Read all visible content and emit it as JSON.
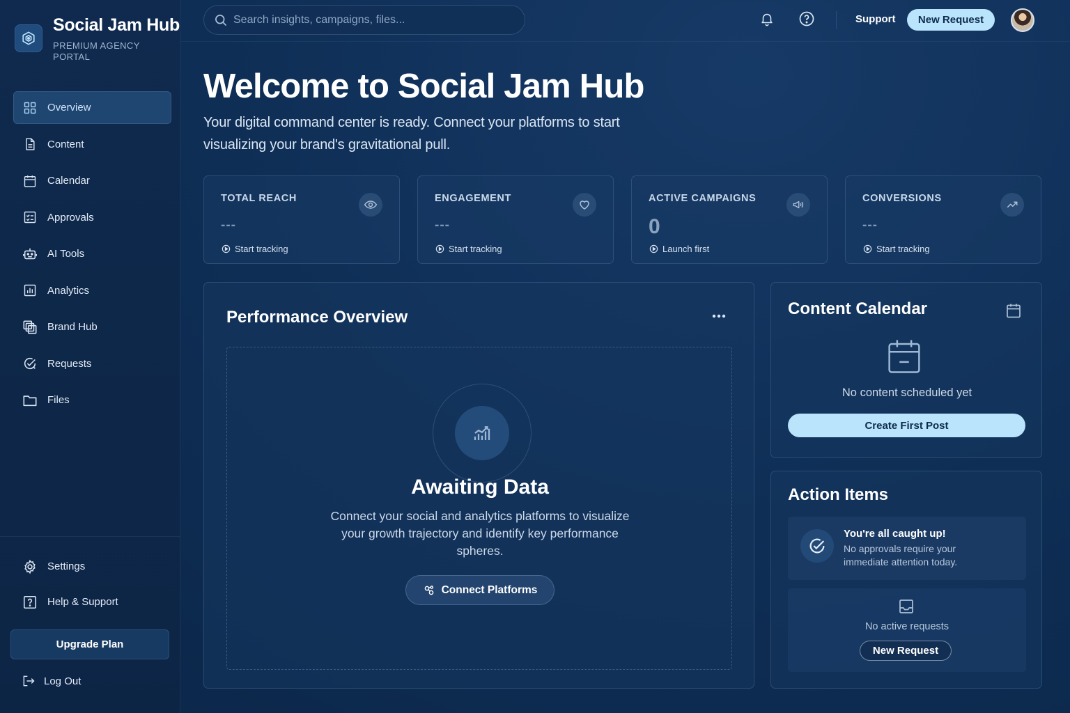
{
  "brand": {
    "name": "Social Jam Hub",
    "subtitle_line1": "PREMIUM AGENCY",
    "subtitle_line2": "PORTAL",
    "logo_icon": "hexagon-logo-icon"
  },
  "sidebar": {
    "items": [
      {
        "label": "Overview",
        "icon": "grid-icon",
        "active": true
      },
      {
        "label": "Content",
        "icon": "document-icon"
      },
      {
        "label": "Calendar",
        "icon": "calendar-icon"
      },
      {
        "label": "Approvals",
        "icon": "checklist-icon"
      },
      {
        "label": "AI Tools",
        "icon": "robot-icon"
      },
      {
        "label": "Analytics",
        "icon": "bar-chart-icon"
      },
      {
        "label": "Brand Hub",
        "icon": "layers-icon"
      },
      {
        "label": "Requests",
        "icon": "check-request-icon"
      },
      {
        "label": "Files",
        "icon": "folder-icon"
      }
    ],
    "bottom_items": [
      {
        "label": "Settings",
        "icon": "gear-icon"
      },
      {
        "label": "Help & Support",
        "icon": "help-icon"
      }
    ],
    "upgrade_label": "Upgrade Plan",
    "logout_label": "Log Out"
  },
  "topbar": {
    "search_placeholder": "Search insights, campaigns, files...",
    "support_label": "Support",
    "new_request_label": "New Request"
  },
  "hero": {
    "title": "Welcome to Social Jam Hub",
    "subtitle": "Your digital command center is ready. Connect your platforms to start visualizing your brand's gravitational pull."
  },
  "stats": [
    {
      "label": "TOTAL REACH",
      "value": "---",
      "link": "Start tracking",
      "icon": "eye-icon"
    },
    {
      "label": "ENGAGEMENT",
      "value": "---",
      "link": "Start tracking",
      "icon": "heart-icon"
    },
    {
      "label": "ACTIVE CAMPAIGNS",
      "value": "0",
      "link": "Launch first",
      "icon": "megaphone-icon"
    },
    {
      "label": "CONVERSIONS",
      "value": "---",
      "link": "Start tracking",
      "icon": "trending-up-icon"
    }
  ],
  "performance": {
    "title": "Performance Overview",
    "empty_title": "Awaiting Data",
    "empty_text": "Connect your social and analytics platforms to visualize your growth trajectory and identify key performance spheres.",
    "connect_label": "Connect Platforms"
  },
  "calendar": {
    "title": "Content Calendar",
    "empty_text": "No content scheduled yet",
    "button_label": "Create First Post"
  },
  "actions": {
    "title": "Action Items",
    "caught_title": "You're all caught up!",
    "caught_text": "No approvals require your immediate attention today.",
    "requests_text": "No active requests",
    "requests_button": "New Request"
  },
  "colors": {
    "accent": "#b9e4fb",
    "background": "#0f2f57",
    "sidebar": "#0f2a4e"
  }
}
